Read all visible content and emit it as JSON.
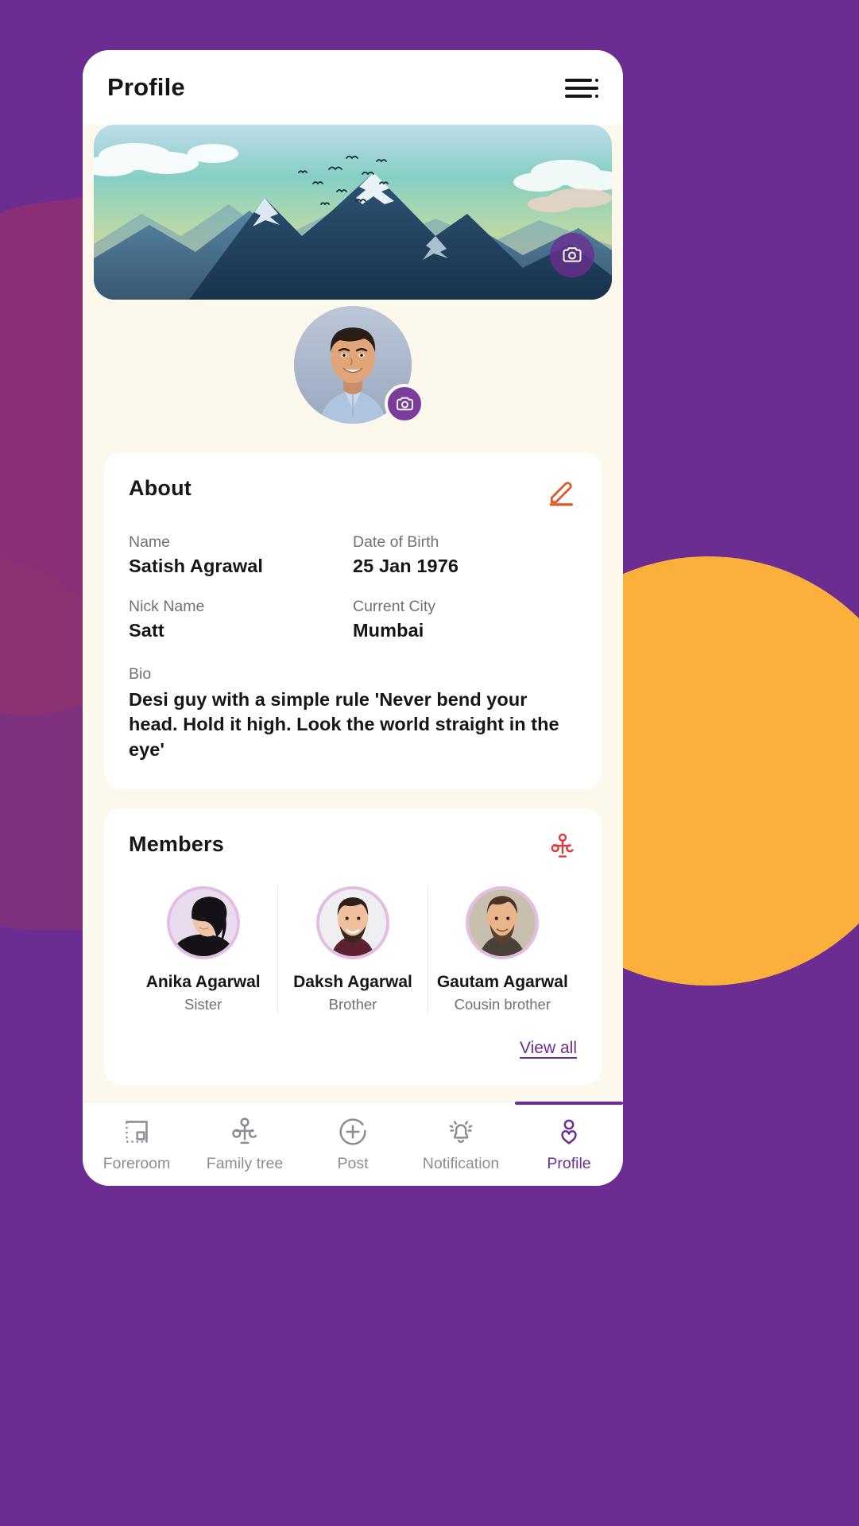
{
  "theme": {
    "background_purple": "#6B2D91",
    "accent_purple": "#7B3C9B",
    "accent_orange": "#FBB03B",
    "edit_icon_color": "#E05A2B",
    "members_icon_color": "#E03A3A",
    "card_background": "#FFFFFF",
    "app_background": "#FDF8EC"
  },
  "header": {
    "title": "Profile",
    "menu_icon": "hamburger-menu-icon"
  },
  "cover": {
    "image_alt": "mountain-landscape-cover",
    "camera_button_icon": "camera-icon"
  },
  "avatar": {
    "image_alt": "user-profile-photo",
    "camera_button_icon": "camera-icon"
  },
  "about": {
    "title": "About",
    "edit_icon": "edit-pencil-icon",
    "fields": [
      {
        "label": "Name",
        "value": "Satish Agrawal"
      },
      {
        "label": "Date of Birth",
        "value": "25 Jan 1976"
      },
      {
        "label": "Nick Name",
        "value": "Satt"
      },
      {
        "label": "Current City",
        "value": "Mumbai"
      }
    ],
    "bio": {
      "label": "Bio",
      "value": "Desi guy with a simple rule 'Never bend your head. Hold it high. Look the world straight in the eye'"
    }
  },
  "members": {
    "title": "Members",
    "tree_icon": "family-tree-icon",
    "list": [
      {
        "name": "Anika Agarwal",
        "relation": "Sister",
        "avatar_alt": "anika-avatar"
      },
      {
        "name": "Daksh Agarwal",
        "relation": "Brother",
        "avatar_alt": "daksh-avatar"
      },
      {
        "name": "Gautam Agarwal",
        "relation": "Cousin brother",
        "avatar_alt": "gautam-avatar"
      }
    ],
    "view_all_label": "View all"
  },
  "bottom_nav": {
    "items": [
      {
        "label": "Foreroom",
        "icon": "foreroom-icon",
        "active": false
      },
      {
        "label": "Family tree",
        "icon": "family-tree-icon",
        "active": false
      },
      {
        "label": "Post",
        "icon": "plus-circle-icon",
        "active": false
      },
      {
        "label": "Notification",
        "icon": "bell-icon",
        "active": false
      },
      {
        "label": "Profile",
        "icon": "profile-heart-icon",
        "active": true
      }
    ]
  }
}
